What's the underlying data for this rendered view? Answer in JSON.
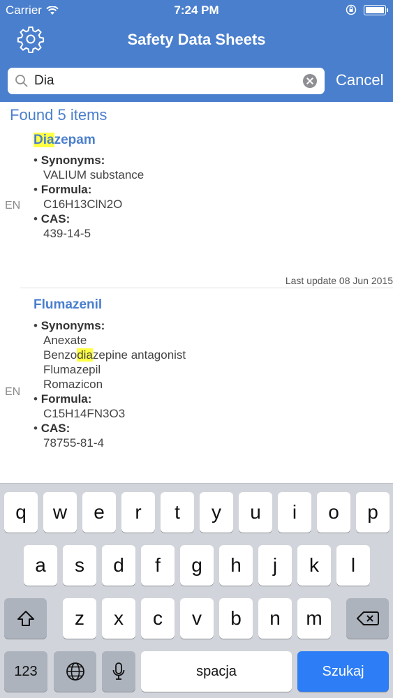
{
  "status": {
    "carrier": "Carrier",
    "time": "7:24 PM"
  },
  "nav": {
    "title": "Safety Data Sheets"
  },
  "search": {
    "value": "Dia",
    "cancel_label": "Cancel"
  },
  "results_header": "Found 5 items",
  "entries": [
    {
      "lang": "EN",
      "title_highlight": "Dia",
      "title_rest": "zepam",
      "synonyms_label": "Synonyms:",
      "synonyms": [
        "VALIUM substance"
      ],
      "formula_label": "Formula:",
      "formula": "C16H13ClN2O",
      "cas_label": "CAS:",
      "cas": "439-14-5",
      "last_update": "Last update 08 Jun 2015"
    },
    {
      "lang": "EN",
      "title": "Flumazenil",
      "synonyms_label": "Synonyms:",
      "synonym_1": "Anexate",
      "synonym_2_pre": "Benzo",
      "synonym_2_hl": "dia",
      "synonym_2_post": "zepine antagonist",
      "synonym_3": "Flumazepil",
      "synonym_4": "Romazicon",
      "formula_label": "Formula:",
      "formula": "C15H14FN3O3",
      "cas_label": "CAS:",
      "cas": "78755-81-4"
    }
  ],
  "keyboard": {
    "row1": [
      "q",
      "w",
      "e",
      "r",
      "t",
      "y",
      "u",
      "i",
      "o",
      "p"
    ],
    "row2": [
      "a",
      "s",
      "d",
      "f",
      "g",
      "h",
      "j",
      "k",
      "l"
    ],
    "row3": [
      "z",
      "x",
      "c",
      "v",
      "b",
      "n",
      "m"
    ],
    "numbers_label": "123",
    "space_label": "spacja",
    "search_label": "Szukaj"
  },
  "colors": {
    "accent": "#4a7fcd",
    "highlight": "#ffff44",
    "keyboard_bg": "#d1d4da",
    "search_key": "#2d7df6"
  }
}
